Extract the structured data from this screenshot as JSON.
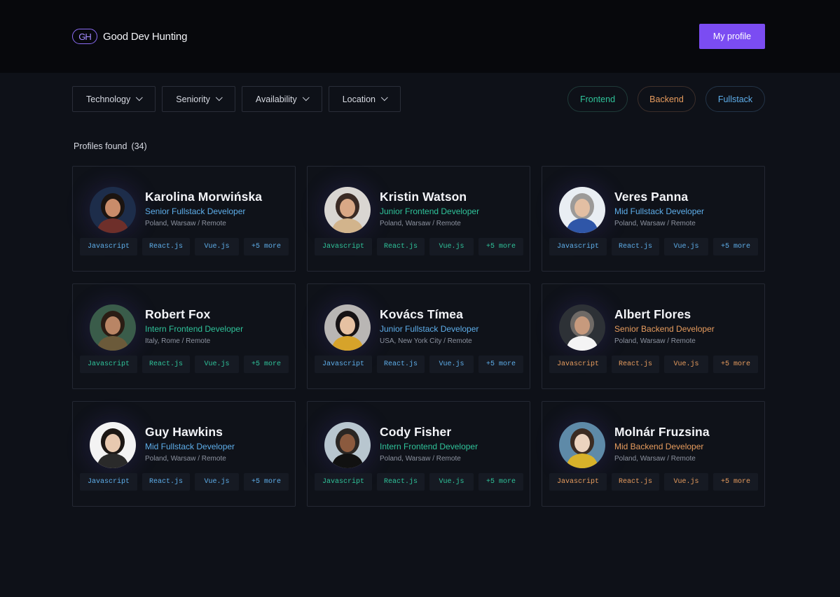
{
  "header": {
    "logo_mark": "GH",
    "brand": "Good Dev Hunting",
    "my_profile_label": "My profile"
  },
  "filters": [
    "Technology",
    "Seniority",
    "Availability",
    "Location"
  ],
  "specialization_pills": [
    "Frontend",
    "Backend",
    "Fullstack"
  ],
  "results": {
    "label": "Profiles found",
    "count": "(34)"
  },
  "colors": {
    "accent": "#7b4cf2",
    "frontend": "#2fc39a",
    "backend": "#e79c5e",
    "fullstack": "#5eaeea",
    "background": "#0e1118"
  },
  "profiles": [
    {
      "name": "Karolina Morwińska",
      "role": "Senior Fullstack Developer",
      "location": "Poland, Warsaw / Remote",
      "tags": [
        "Javascript",
        "React.js",
        "Vue.js",
        "+5 more"
      ],
      "color": "fullstack"
    },
    {
      "name": "Kristin Watson",
      "role": "Junior Frontend Developer",
      "location": "Poland, Warsaw / Remote",
      "tags": [
        "Javascript",
        "React.js",
        "Vue.js",
        "+5 more"
      ],
      "color": "frontend"
    },
    {
      "name": "Veres Panna",
      "role": "Mid Fullstack Developer",
      "location": "Poland, Warsaw / Remote",
      "tags": [
        "Javascript",
        "React.js",
        "Vue.js",
        "+5 more"
      ],
      "color": "fullstack"
    },
    {
      "name": "Robert Fox",
      "role": "Intern Frontend Developer",
      "location": "Italy, Rome / Remote",
      "tags": [
        "Javascript",
        "React.js",
        "Vue.js",
        "+5 more"
      ],
      "color": "frontend"
    },
    {
      "name": "Kovács Tímea",
      "role": "Junior Fullstack Developer",
      "location": "USA, New York City / Remote",
      "tags": [
        "Javascript",
        "React.js",
        "Vue.js",
        "+5 more"
      ],
      "color": "fullstack"
    },
    {
      "name": "Albert Flores",
      "role": "Senior Backend Developer",
      "location": "Poland, Warsaw / Remote",
      "tags": [
        "Javascript",
        "React.js",
        "Vue.js",
        "+5 more"
      ],
      "color": "backend"
    },
    {
      "name": "Guy Hawkins",
      "role": "Mid Fullstack Developer",
      "location": "Poland, Warsaw / Remote",
      "tags": [
        "Javascript",
        "React.js",
        "Vue.js",
        "+5 more"
      ],
      "color": "fullstack"
    },
    {
      "name": "Cody Fisher",
      "role": "Intern Frontend Developer",
      "location": "Poland, Warsaw / Remote",
      "tags": [
        "Javascript",
        "React.js",
        "Vue.js",
        "+5 more"
      ],
      "color": "frontend"
    },
    {
      "name": "Molnár Fruzsina",
      "role": "Mid Backend Developer",
      "location": "Poland, Warsaw / Remote",
      "tags": [
        "Javascript",
        "React.js",
        "Vue.js",
        "+5 more"
      ],
      "color": "backend"
    }
  ]
}
